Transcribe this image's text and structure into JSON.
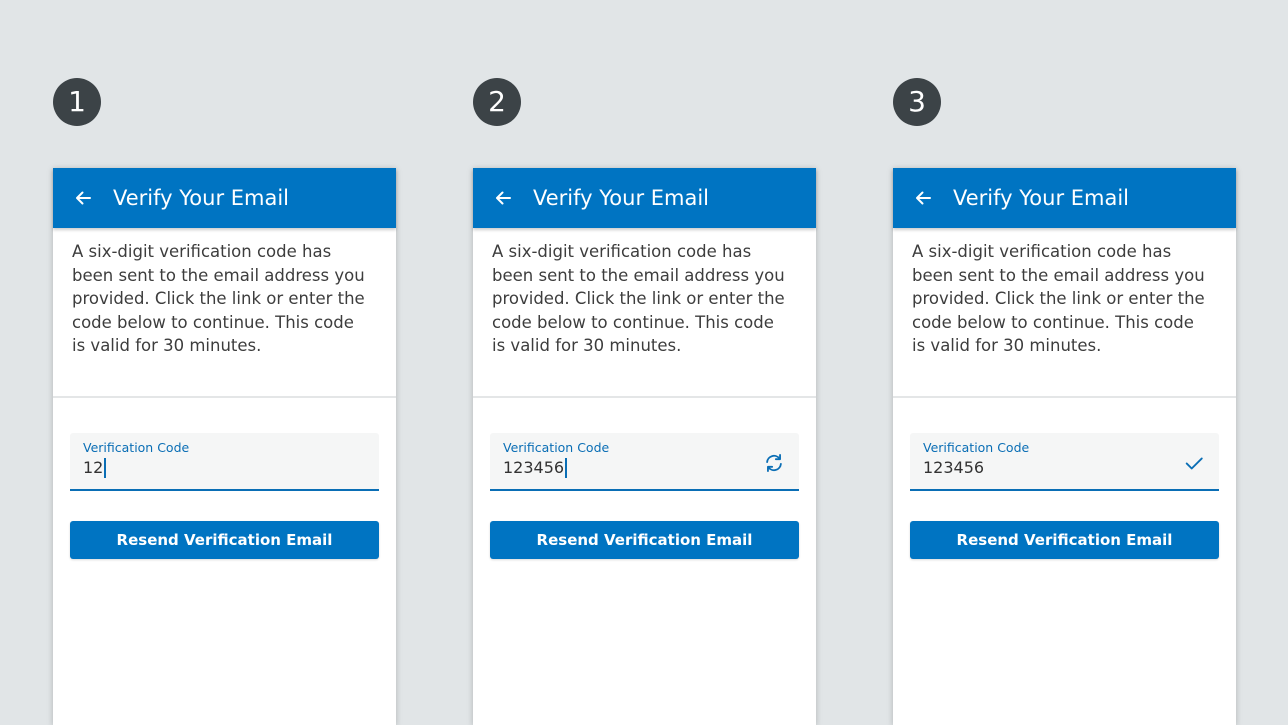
{
  "colors": {
    "background": "#e1e5e7",
    "appbar": "#0074c2",
    "accent": "#0a6eb5",
    "badge": "#3c4347",
    "text": "#3d3d3d"
  },
  "steps": [
    {
      "number": "1",
      "title": "Verify Your Email",
      "back_icon": "arrow-left-icon",
      "message": "A six-digit verification code has been sent to the email address you provided. Click the link or enter the code below to continue. This code is valid for 30 minutes.",
      "field_label": "Verification Code",
      "field_value": "12",
      "cursor_visible": true,
      "status_icon": "",
      "button_label": "Resend Verification Email"
    },
    {
      "number": "2",
      "title": "Verify Your Email",
      "back_icon": "arrow-left-icon",
      "message": "A six-digit verification code has been sent to the email address you provided. Click the link or enter the code below to continue. This code is valid for 30 minutes.",
      "field_label": "Verification Code",
      "field_value": "123456",
      "cursor_visible": true,
      "status_icon": "refresh-icon",
      "button_label": "Resend Verification Email"
    },
    {
      "number": "3",
      "title": "Verify Your Email",
      "back_icon": "arrow-left-icon",
      "message": "A six-digit verification code has been sent to the email address you provided. Click the link or enter the code below to continue. This code is valid for 30 minutes.",
      "field_label": "Verification Code",
      "field_value": "123456",
      "cursor_visible": false,
      "status_icon": "checkmark-icon",
      "button_label": "Resend Verification Email"
    }
  ]
}
